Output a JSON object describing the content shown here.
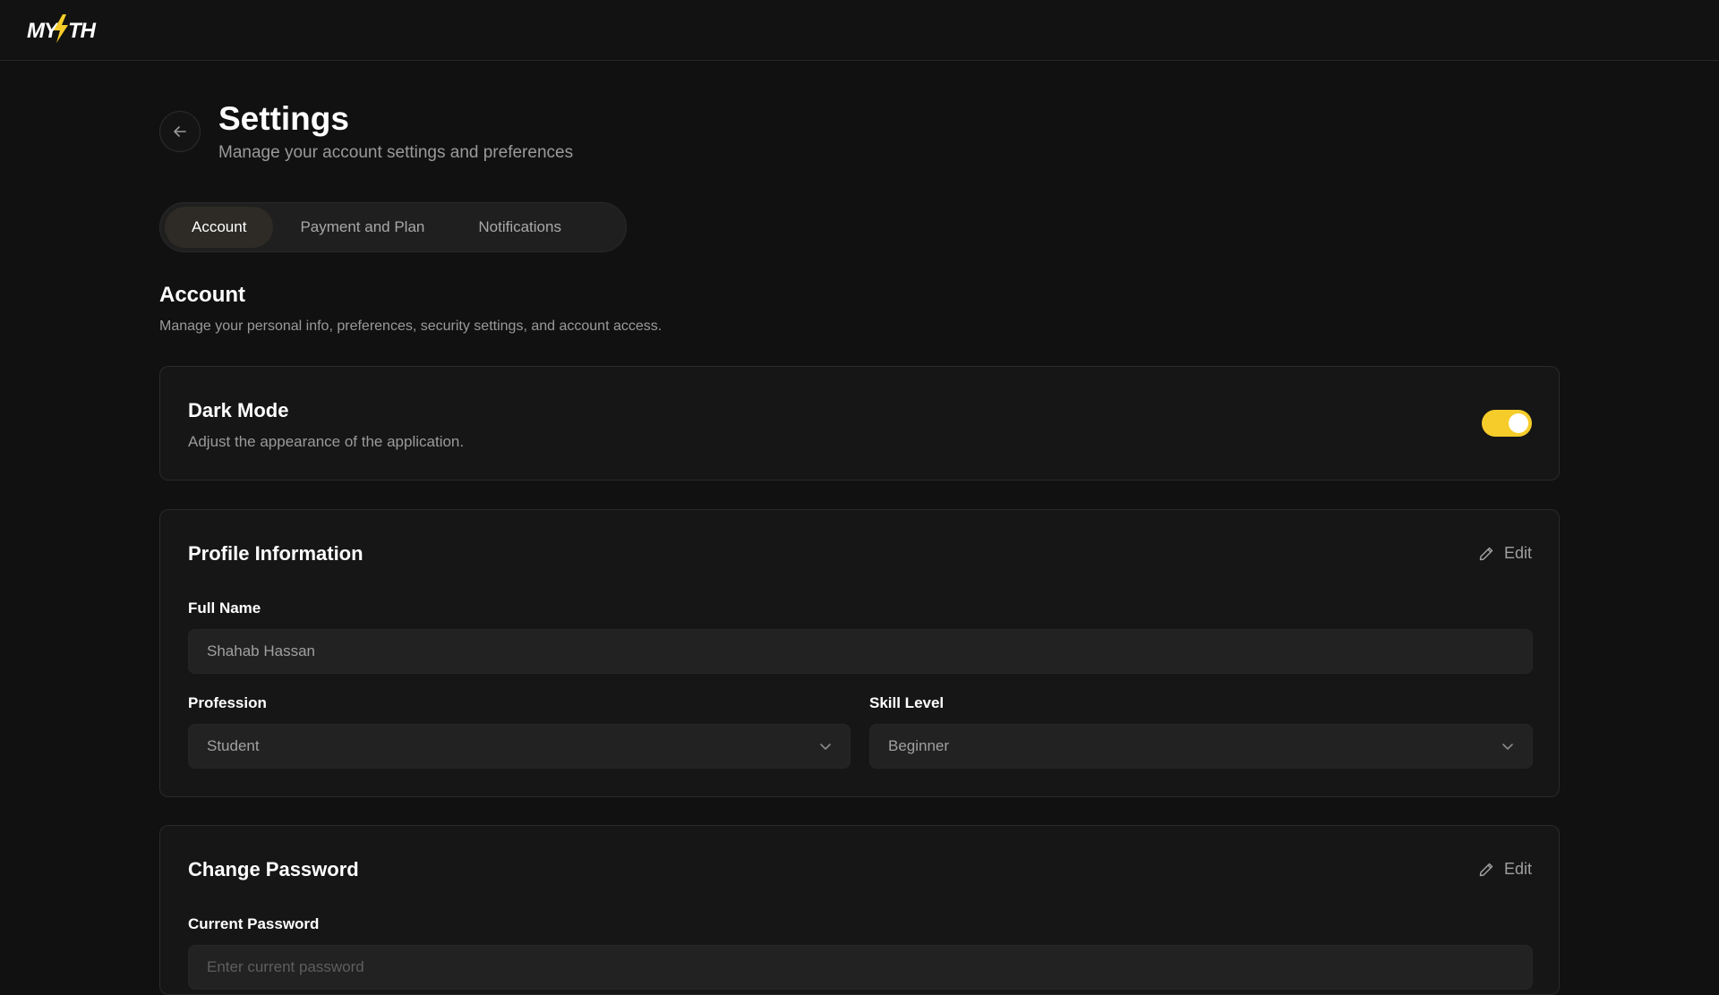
{
  "brand": {
    "logo_text": "MYTH"
  },
  "header": {
    "title": "Settings",
    "subtitle": "Manage your account settings and preferences"
  },
  "tabs": [
    {
      "label": "Account",
      "active": true
    },
    {
      "label": "Payment and Plan",
      "active": false
    },
    {
      "label": "Notifications",
      "active": false
    }
  ],
  "section": {
    "title": "Account",
    "description": "Manage your personal info, preferences, security settings, and account access."
  },
  "dark_mode": {
    "title": "Dark Mode",
    "description": "Adjust the appearance of the application.",
    "enabled": true
  },
  "profile": {
    "title": "Profile Information",
    "edit_label": "Edit",
    "full_name_label": "Full Name",
    "full_name_value": "Shahab Hassan",
    "profession_label": "Profession",
    "profession_value": "Student",
    "skill_label": "Skill Level",
    "skill_value": "Beginner"
  },
  "password": {
    "title": "Change Password",
    "edit_label": "Edit",
    "current_label": "Current Password",
    "current_placeholder": "Enter current password"
  },
  "colors": {
    "accent": "#f5cc2a",
    "background": "#111111",
    "card": "#161616"
  },
  "icons": {
    "back": "arrow-left-icon",
    "edit": "pencil-icon",
    "select": "chevron-down-icon"
  }
}
